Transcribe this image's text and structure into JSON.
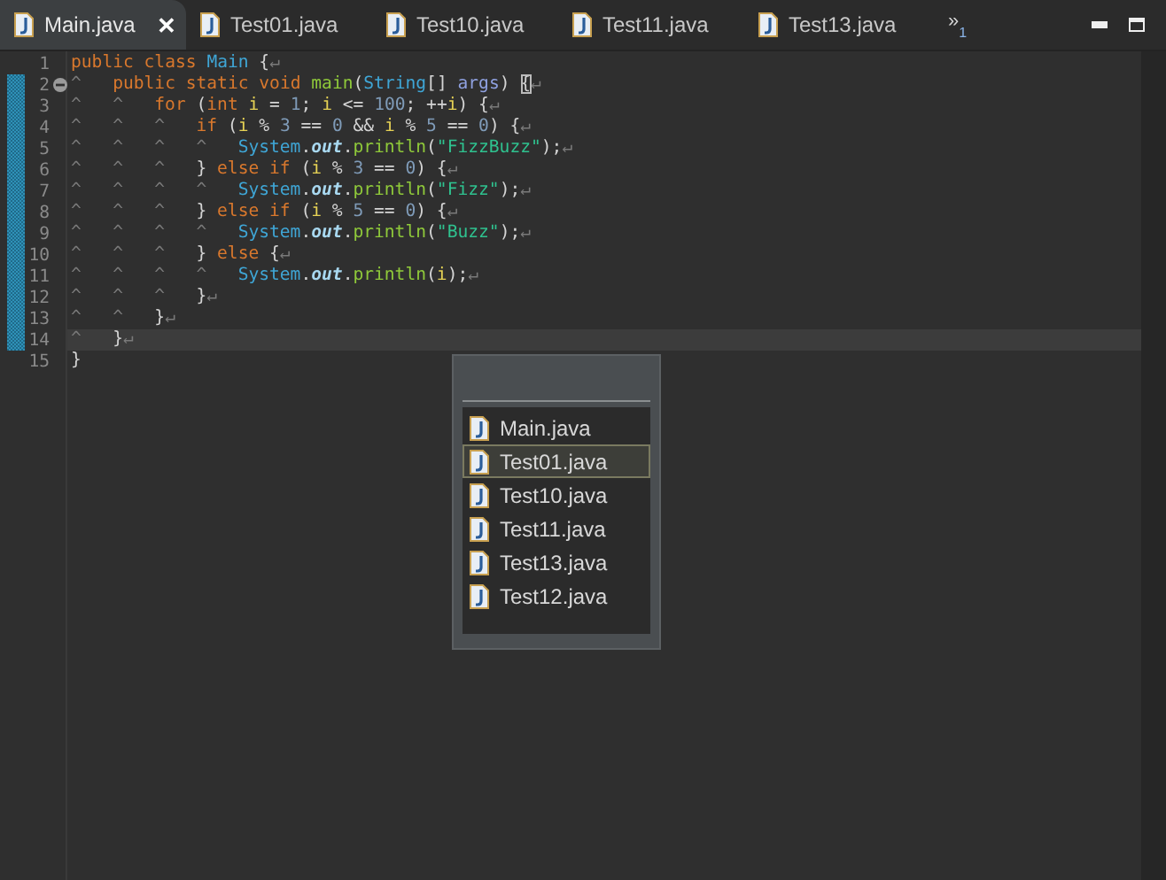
{
  "tabs": [
    {
      "label": "Main.java",
      "selected": true,
      "close": "✕"
    },
    {
      "label": "Test01.java",
      "selected": false
    },
    {
      "label": "Test10.java",
      "selected": false
    },
    {
      "label": "Test11.java",
      "selected": false
    },
    {
      "label": "Test13.java",
      "selected": false
    }
  ],
  "overflow": {
    "symbol": "»",
    "count": "1"
  },
  "editor": {
    "lines": [
      {
        "number": "1",
        "changed": false,
        "fold_marker": false,
        "current": false,
        "tokens": [
          {
            "kind": "kw",
            "text": "public class "
          },
          {
            "kind": "type",
            "text": "Main"
          },
          {
            "kind": "plain",
            "text": " {"
          },
          {
            "kind": "eol",
            "text": "↵"
          }
        ]
      },
      {
        "number": "2",
        "changed": true,
        "fold_marker": true,
        "current": false,
        "tokens": [
          {
            "kind": "tab",
            "text": "^"
          },
          {
            "kind": "kw",
            "text": "public static void "
          },
          {
            "kind": "method",
            "text": "main"
          },
          {
            "kind": "plain",
            "text": "("
          },
          {
            "kind": "type",
            "text": "String"
          },
          {
            "kind": "plain",
            "text": "[] "
          },
          {
            "kind": "param",
            "text": "args"
          },
          {
            "kind": "plain",
            "text": ") "
          },
          {
            "kind": "match",
            "text": "{"
          },
          {
            "kind": "eol",
            "text": "↵"
          }
        ]
      },
      {
        "number": "3",
        "changed": true,
        "fold_marker": false,
        "current": false,
        "tokens": [
          {
            "kind": "tab",
            "text": "^"
          },
          {
            "kind": "tab",
            "text": "^"
          },
          {
            "kind": "kw",
            "text": "for"
          },
          {
            "kind": "plain",
            "text": " ("
          },
          {
            "kind": "kw",
            "text": "int "
          },
          {
            "kind": "var",
            "text": "i"
          },
          {
            "kind": "plain",
            "text": " = "
          },
          {
            "kind": "num",
            "text": "1"
          },
          {
            "kind": "plain",
            "text": "; "
          },
          {
            "kind": "var",
            "text": "i"
          },
          {
            "kind": "plain",
            "text": " <= "
          },
          {
            "kind": "num",
            "text": "100"
          },
          {
            "kind": "plain",
            "text": "; ++"
          },
          {
            "kind": "var",
            "text": "i"
          },
          {
            "kind": "plain",
            "text": ") {"
          },
          {
            "kind": "eol",
            "text": "↵"
          }
        ]
      },
      {
        "number": "4",
        "changed": true,
        "fold_marker": false,
        "current": false,
        "tokens": [
          {
            "kind": "tab",
            "text": "^"
          },
          {
            "kind": "tab",
            "text": "^"
          },
          {
            "kind": "tab",
            "text": "^"
          },
          {
            "kind": "kw",
            "text": "if"
          },
          {
            "kind": "plain",
            "text": " ("
          },
          {
            "kind": "var",
            "text": "i"
          },
          {
            "kind": "plain",
            "text": " % "
          },
          {
            "kind": "num",
            "text": "3"
          },
          {
            "kind": "plain",
            "text": " == "
          },
          {
            "kind": "num",
            "text": "0"
          },
          {
            "kind": "plain",
            "text": " && "
          },
          {
            "kind": "var",
            "text": "i"
          },
          {
            "kind": "plain",
            "text": " % "
          },
          {
            "kind": "num",
            "text": "5"
          },
          {
            "kind": "plain",
            "text": " == "
          },
          {
            "kind": "num",
            "text": "0"
          },
          {
            "kind": "plain",
            "text": ") {"
          },
          {
            "kind": "eol",
            "text": "↵"
          }
        ]
      },
      {
        "number": "5",
        "changed": true,
        "fold_marker": false,
        "current": false,
        "tokens": [
          {
            "kind": "tab",
            "text": "^"
          },
          {
            "kind": "tab",
            "text": "^"
          },
          {
            "kind": "tab",
            "text": "^"
          },
          {
            "kind": "tab",
            "text": "^"
          },
          {
            "kind": "type",
            "text": "System"
          },
          {
            "kind": "plain",
            "text": "."
          },
          {
            "kind": "field",
            "text": "out"
          },
          {
            "kind": "plain",
            "text": "."
          },
          {
            "kind": "call",
            "text": "println"
          },
          {
            "kind": "plain",
            "text": "("
          },
          {
            "kind": "str",
            "text": "\"FizzBuzz\""
          },
          {
            "kind": "plain",
            "text": ");"
          },
          {
            "kind": "eol",
            "text": "↵"
          }
        ]
      },
      {
        "number": "6",
        "changed": true,
        "fold_marker": false,
        "current": false,
        "tokens": [
          {
            "kind": "tab",
            "text": "^"
          },
          {
            "kind": "tab",
            "text": "^"
          },
          {
            "kind": "tab",
            "text": "^"
          },
          {
            "kind": "plain",
            "text": "} "
          },
          {
            "kind": "kw",
            "text": "else if"
          },
          {
            "kind": "plain",
            "text": " ("
          },
          {
            "kind": "var",
            "text": "i"
          },
          {
            "kind": "plain",
            "text": " % "
          },
          {
            "kind": "num",
            "text": "3"
          },
          {
            "kind": "plain",
            "text": " == "
          },
          {
            "kind": "num",
            "text": "0"
          },
          {
            "kind": "plain",
            "text": ") {"
          },
          {
            "kind": "eol",
            "text": "↵"
          }
        ]
      },
      {
        "number": "7",
        "changed": true,
        "fold_marker": false,
        "current": false,
        "tokens": [
          {
            "kind": "tab",
            "text": "^"
          },
          {
            "kind": "tab",
            "text": "^"
          },
          {
            "kind": "tab",
            "text": "^"
          },
          {
            "kind": "tab",
            "text": "^"
          },
          {
            "kind": "type",
            "text": "System"
          },
          {
            "kind": "plain",
            "text": "."
          },
          {
            "kind": "field",
            "text": "out"
          },
          {
            "kind": "plain",
            "text": "."
          },
          {
            "kind": "call",
            "text": "println"
          },
          {
            "kind": "plain",
            "text": "("
          },
          {
            "kind": "str",
            "text": "\"Fizz\""
          },
          {
            "kind": "plain",
            "text": ");"
          },
          {
            "kind": "eol",
            "text": "↵"
          }
        ]
      },
      {
        "number": "8",
        "changed": true,
        "fold_marker": false,
        "current": false,
        "tokens": [
          {
            "kind": "tab",
            "text": "^"
          },
          {
            "kind": "tab",
            "text": "^"
          },
          {
            "kind": "tab",
            "text": "^"
          },
          {
            "kind": "plain",
            "text": "} "
          },
          {
            "kind": "kw",
            "text": "else if"
          },
          {
            "kind": "plain",
            "text": " ("
          },
          {
            "kind": "var",
            "text": "i"
          },
          {
            "kind": "plain",
            "text": " % "
          },
          {
            "kind": "num",
            "text": "5"
          },
          {
            "kind": "plain",
            "text": " == "
          },
          {
            "kind": "num",
            "text": "0"
          },
          {
            "kind": "plain",
            "text": ") {"
          },
          {
            "kind": "eol",
            "text": "↵"
          }
        ]
      },
      {
        "number": "9",
        "changed": true,
        "fold_marker": false,
        "current": false,
        "tokens": [
          {
            "kind": "tab",
            "text": "^"
          },
          {
            "kind": "tab",
            "text": "^"
          },
          {
            "kind": "tab",
            "text": "^"
          },
          {
            "kind": "tab",
            "text": "^"
          },
          {
            "kind": "type",
            "text": "System"
          },
          {
            "kind": "plain",
            "text": "."
          },
          {
            "kind": "field",
            "text": "out"
          },
          {
            "kind": "plain",
            "text": "."
          },
          {
            "kind": "call",
            "text": "println"
          },
          {
            "kind": "plain",
            "text": "("
          },
          {
            "kind": "str",
            "text": "\"Buzz\""
          },
          {
            "kind": "plain",
            "text": ");"
          },
          {
            "kind": "eol",
            "text": "↵"
          }
        ]
      },
      {
        "number": "10",
        "changed": true,
        "fold_marker": false,
        "current": false,
        "tokens": [
          {
            "kind": "tab",
            "text": "^"
          },
          {
            "kind": "tab",
            "text": "^"
          },
          {
            "kind": "tab",
            "text": "^"
          },
          {
            "kind": "plain",
            "text": "} "
          },
          {
            "kind": "kw",
            "text": "else"
          },
          {
            "kind": "plain",
            "text": " {"
          },
          {
            "kind": "eol",
            "text": "↵"
          }
        ]
      },
      {
        "number": "11",
        "changed": true,
        "fold_marker": false,
        "current": false,
        "tokens": [
          {
            "kind": "tab",
            "text": "^"
          },
          {
            "kind": "tab",
            "text": "^"
          },
          {
            "kind": "tab",
            "text": "^"
          },
          {
            "kind": "tab",
            "text": "^"
          },
          {
            "kind": "type",
            "text": "System"
          },
          {
            "kind": "plain",
            "text": "."
          },
          {
            "kind": "field",
            "text": "out"
          },
          {
            "kind": "plain",
            "text": "."
          },
          {
            "kind": "call",
            "text": "println"
          },
          {
            "kind": "plain",
            "text": "("
          },
          {
            "kind": "var",
            "text": "i"
          },
          {
            "kind": "plain",
            "text": ");"
          },
          {
            "kind": "eol",
            "text": "↵"
          }
        ]
      },
      {
        "number": "12",
        "changed": true,
        "fold_marker": false,
        "current": false,
        "tokens": [
          {
            "kind": "tab",
            "text": "^"
          },
          {
            "kind": "tab",
            "text": "^"
          },
          {
            "kind": "tab",
            "text": "^"
          },
          {
            "kind": "plain",
            "text": "}"
          },
          {
            "kind": "eol",
            "text": "↵"
          }
        ]
      },
      {
        "number": "13",
        "changed": true,
        "fold_marker": false,
        "current": false,
        "tokens": [
          {
            "kind": "tab",
            "text": "^"
          },
          {
            "kind": "tab",
            "text": "^"
          },
          {
            "kind": "plain",
            "text": "}"
          },
          {
            "kind": "eol",
            "text": "↵"
          }
        ]
      },
      {
        "number": "14",
        "changed": true,
        "fold_marker": false,
        "current": true,
        "tokens": [
          {
            "kind": "tab",
            "text": "^"
          },
          {
            "kind": "plain",
            "text": "}"
          },
          {
            "kind": "eol",
            "text": "↵"
          }
        ]
      },
      {
        "number": "15",
        "changed": false,
        "fold_marker": false,
        "current": false,
        "tokens": [
          {
            "kind": "plain",
            "text": "}"
          }
        ]
      }
    ]
  },
  "switcher": {
    "items": [
      {
        "label": "Main.java",
        "selected": false
      },
      {
        "label": "Test01.java",
        "selected": true
      },
      {
        "label": "Test10.java",
        "selected": false
      },
      {
        "label": "Test11.java",
        "selected": false
      },
      {
        "label": "Test13.java",
        "selected": false
      },
      {
        "label": "Test12.java",
        "selected": false
      }
    ]
  }
}
